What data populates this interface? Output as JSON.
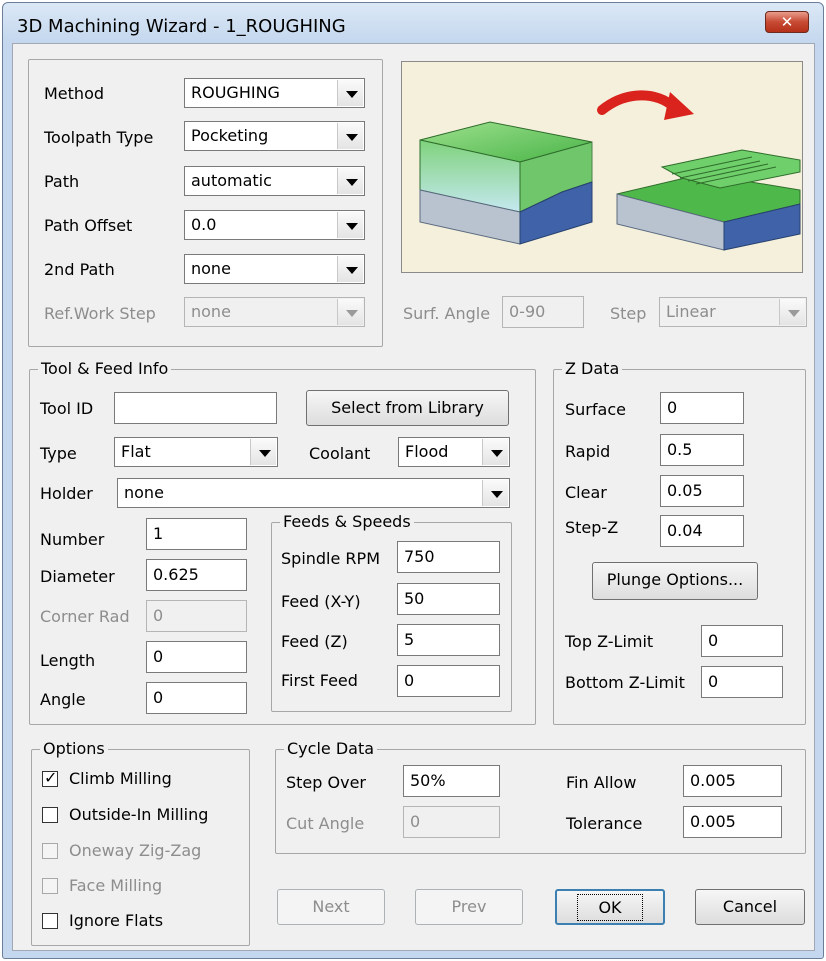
{
  "window": {
    "title": "3D Machining Wizard - 1_ROUGHING",
    "close_label": "✕"
  },
  "method_group": {
    "method": {
      "label": "Method",
      "value": "ROUGHING"
    },
    "toolpath_type": {
      "label": "Toolpath Type",
      "value": "Pocketing"
    },
    "path": {
      "label": "Path",
      "value": "automatic"
    },
    "path_offset": {
      "label": "Path Offset",
      "value": "0.0"
    },
    "second_path": {
      "label": "2nd Path",
      "value": "none"
    },
    "ref_work_step": {
      "label": "Ref.Work Step",
      "value": "none"
    }
  },
  "surf_angle": {
    "label": "Surf. Angle",
    "value": "0-90"
  },
  "step": {
    "label": "Step",
    "value": "Linear"
  },
  "tool_feed": {
    "title": "Tool & Feed Info",
    "tool_id": {
      "label": "Tool ID",
      "value": ""
    },
    "select_library_label": "Select from Library",
    "type": {
      "label": "Type",
      "value": "Flat"
    },
    "coolant": {
      "label": "Coolant",
      "value": "Flood"
    },
    "holder": {
      "label": "Holder",
      "value": "none"
    },
    "number": {
      "label": "Number",
      "value": "1"
    },
    "diameter": {
      "label": "Diameter",
      "value": "0.625"
    },
    "corner_rad": {
      "label": "Corner Rad",
      "value": "0"
    },
    "length": {
      "label": "Length",
      "value": "0"
    },
    "angle": {
      "label": "Angle",
      "value": "0"
    }
  },
  "feeds_speeds": {
    "title": "Feeds & Speeds",
    "spindle_rpm": {
      "label": "Spindle RPM",
      "value": "750"
    },
    "feed_xy": {
      "label": "Feed (X-Y)",
      "value": "50"
    },
    "feed_z": {
      "label": "Feed (Z)",
      "value": "5"
    },
    "first_feed": {
      "label": "First Feed",
      "value": "0"
    }
  },
  "z_data": {
    "title": "Z Data",
    "surface": {
      "label": "Surface",
      "value": "0"
    },
    "rapid": {
      "label": "Rapid",
      "value": "0.5"
    },
    "clear": {
      "label": "Clear",
      "value": "0.05"
    },
    "step_z": {
      "label": "Step-Z",
      "value": "0.04"
    },
    "plunge_label": "Plunge Options...",
    "top_z_limit": {
      "label": "Top Z-Limit",
      "value": "0"
    },
    "bottom_z_limit": {
      "label": "Bottom Z-Limit",
      "value": "0"
    }
  },
  "options": {
    "title": "Options",
    "climb_milling": {
      "label": "Climb Milling",
      "checked": true
    },
    "outside_in": {
      "label": "Outside-In Milling",
      "checked": false
    },
    "oneway_zigzag": {
      "label": "Oneway Zig-Zag",
      "checked": false
    },
    "face_milling": {
      "label": "Face Milling",
      "checked": false
    },
    "ignore_flats": {
      "label": "Ignore Flats",
      "checked": false
    }
  },
  "cycle_data": {
    "title": "Cycle Data",
    "step_over": {
      "label": "Step Over",
      "value": "50%"
    },
    "cut_angle": {
      "label": "Cut Angle",
      "value": "0"
    },
    "fin_allow": {
      "label": "Fin Allow",
      "value": "0.005"
    },
    "tolerance": {
      "label": "Tolerance",
      "value": "0.005"
    }
  },
  "buttons": {
    "next": "Next",
    "prev": "Prev",
    "ok": "OK",
    "cancel": "Cancel"
  },
  "colors": {
    "block_green": "#4fb84a",
    "block_blue": "#3f62a8",
    "arrow_red": "#d9231c"
  }
}
